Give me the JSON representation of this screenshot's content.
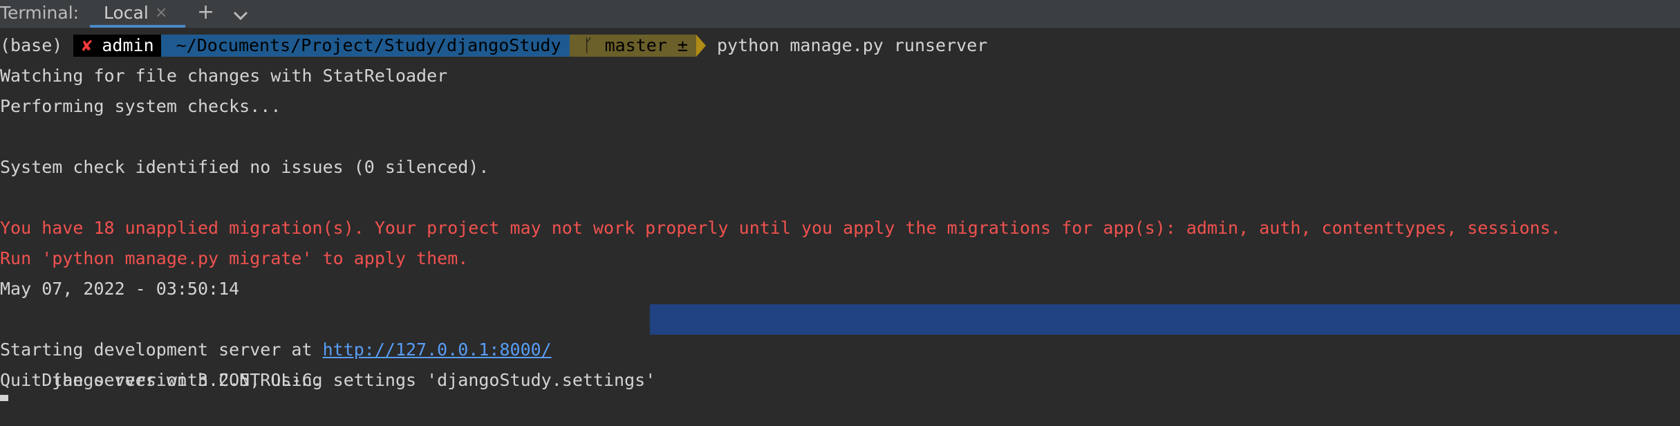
{
  "tabbar": {
    "label": "Terminal:",
    "active_tab": "Local",
    "close_glyph": "×",
    "add_glyph": "+"
  },
  "prompt": {
    "env": "(base)",
    "status_glyph": "✘",
    "user": "admin",
    "path": "~/Documents/Project/Study/djangoStudy",
    "branch_glyph": "ᚴ",
    "branch": "master ±",
    "command": "python manage.py runserver"
  },
  "output": {
    "l1": "Watching for file changes with StatReloader",
    "l2": "Performing system checks...",
    "l3": "",
    "l4": "System check identified no issues (0 silenced).",
    "l5": "",
    "l6": "You have 18 unapplied migration(s). Your project may not work properly until you apply the migrations for app(s): admin, auth, contenttypes, sessions.",
    "l7": "Run 'python manage.py migrate' to apply them.",
    "l8": "May 07, 2022 - 03:50:14",
    "l9": "Django version 3.2.5, using settings 'djangoStudy.settings'",
    "l10_prefix": "Starting development server at ",
    "l10_url": "http://127.0.0.1:8000/",
    "l11": "Quit the server with CONTROL-C."
  },
  "colors": {
    "background": "#2b2b2b",
    "error": "#f0524f",
    "link": "#589df6",
    "selection": "#214283",
    "tab_underline": "#4a88c7"
  },
  "icons": {
    "add": "plus-icon",
    "dropdown": "chevron-down-icon",
    "close": "close-icon",
    "branch": "git-branch-icon",
    "status": "error-x-icon"
  }
}
